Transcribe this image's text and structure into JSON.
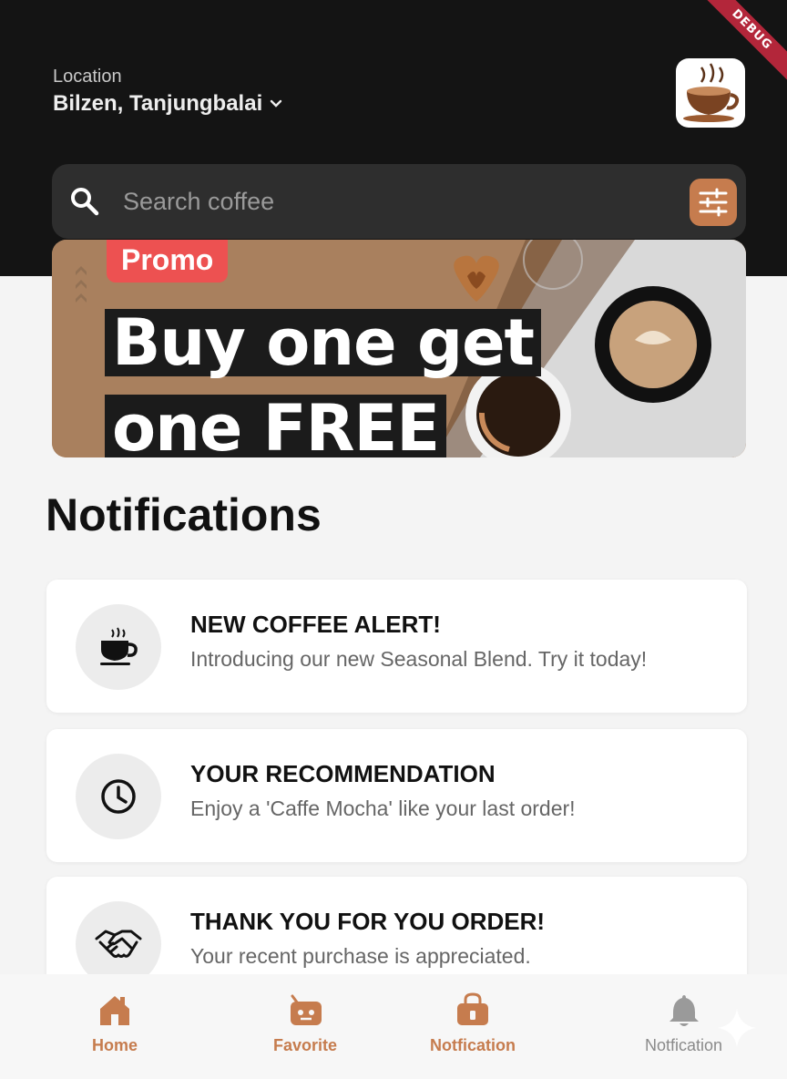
{
  "debug_banner": "DEBUG",
  "header": {
    "location_label": "Location",
    "location_value": "Bilzen, Tanjungbalai"
  },
  "search": {
    "placeholder": "Search coffee"
  },
  "promo": {
    "tag": "Promo",
    "line1": "Buy one get",
    "line2": "one FREE"
  },
  "notifications": {
    "title": "Notifications",
    "items": [
      {
        "title": "NEW COFFEE ALERT!",
        "message": "Introducing our new Seasonal Blend. Try it today!",
        "icon": "coffee-cup-icon"
      },
      {
        "title": "YOUR RECOMMENDATION",
        "message": "Enjoy a 'Caffe Mocha' like your last order!",
        "icon": "clock-icon"
      },
      {
        "title": "THANK YOU FOR YOU ORDER!",
        "message": "Your recent purchase is appreciated.",
        "icon": "handshake-icon"
      }
    ]
  },
  "bottom_nav": [
    {
      "label": "Home",
      "icon": "home-icon",
      "active": true
    },
    {
      "label": "Favorite",
      "icon": "favorite-icon",
      "active": true
    },
    {
      "label": "Notfication",
      "icon": "bag-icon",
      "active": true
    },
    {
      "label": "Notfication",
      "icon": "bell-icon",
      "active": false
    }
  ],
  "colors": {
    "accent": "#c67c4e",
    "header_bg": "#141414",
    "promo_red": "#ed5151"
  }
}
